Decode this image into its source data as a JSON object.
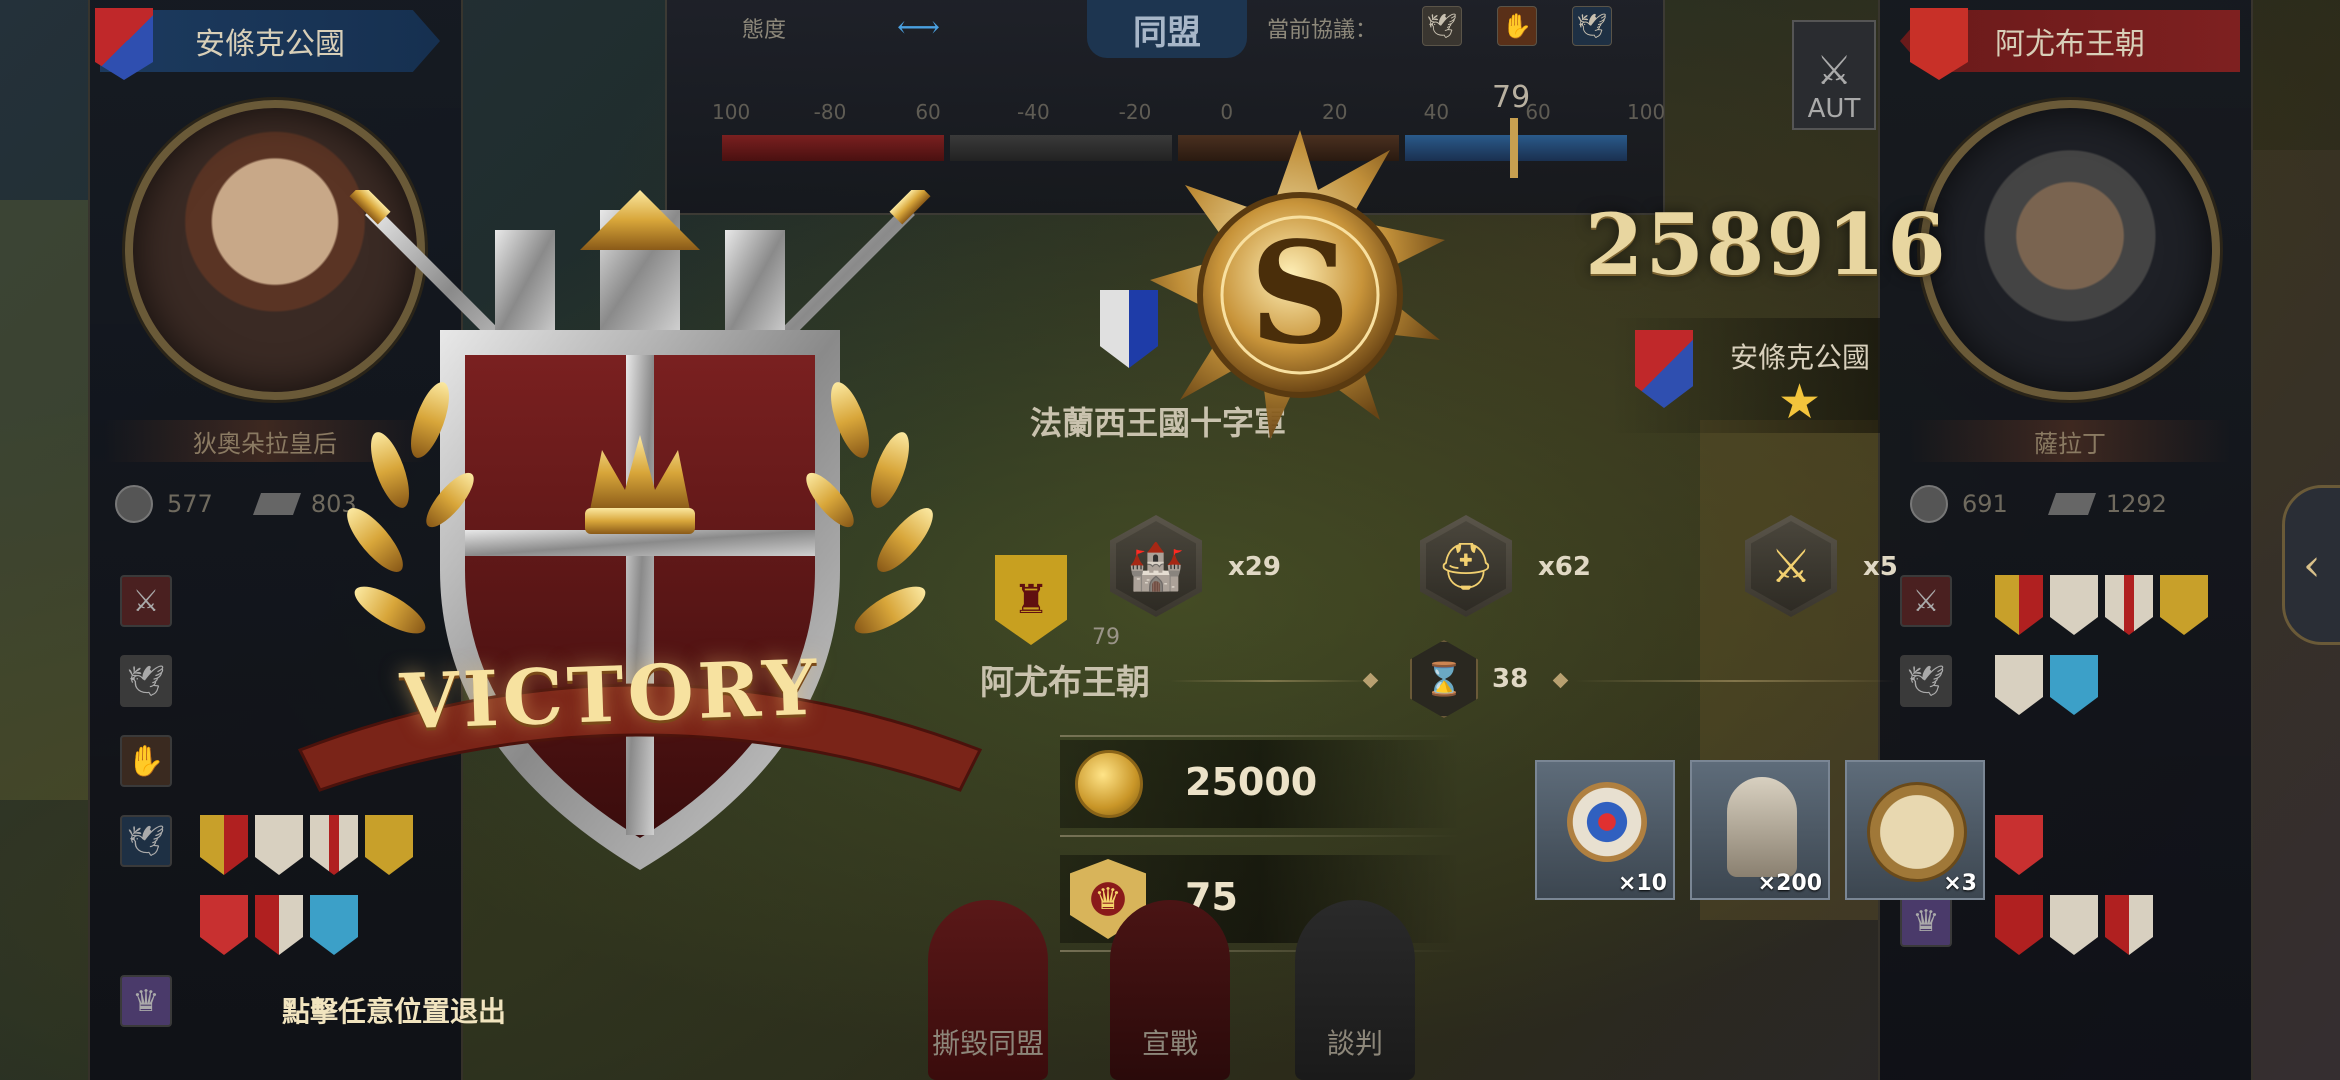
{
  "left_faction": {
    "name": "安條克公國",
    "ruler_title": "狄奧朵拉皇后",
    "stat_1": "577",
    "stat_2": "803",
    "flag_colors": [
      "#c0282a",
      "#2f4fb0"
    ]
  },
  "right_faction": {
    "name": "阿尤布王朝",
    "ruler_title": "薩拉丁",
    "stat_1": "691",
    "stat_2": "1292",
    "flag_colors": [
      "#c0282a",
      "#d4a62a"
    ]
  },
  "diplomacy": {
    "attitude_label": "態度",
    "relation_tab": "同盟",
    "treaty_label": "當前協議：",
    "scale_labels": [
      "100",
      "-80",
      "60",
      "-40",
      "-20",
      "0",
      "20",
      "40",
      "60",
      "100"
    ],
    "relation_value": "79"
  },
  "map": {
    "city_label": "法蘭西王國十字軍",
    "kingdom_label": "阿尤布王朝",
    "kingdom_marker_value": "79"
  },
  "result": {
    "banner_text": "VICTORY",
    "score": "258916",
    "winner_name": "安條克公國",
    "winner_star": "★"
  },
  "units": [
    {
      "icon": "castle-icon",
      "count": "x29"
    },
    {
      "icon": "helmet-icon",
      "count": "x62"
    },
    {
      "icon": "crossed-swords-icon",
      "count": "x5"
    }
  ],
  "turns": {
    "icon": "hourglass-icon",
    "count": "38"
  },
  "rewards": {
    "gold": "25000",
    "honor": "75"
  },
  "items": [
    {
      "icon": "archery-target-icon",
      "count": "×10"
    },
    {
      "icon": "soldier-bust-icon",
      "count": "×200"
    },
    {
      "icon": "compass-icon",
      "count": "×3"
    }
  ],
  "bottom_actions": {
    "break_alliance": "撕毀同盟",
    "declare_war": "宣戰",
    "negotiate": "談判"
  },
  "auto_label": "AUT",
  "exit_hint": "點擊任意位置退出",
  "colors": {
    "gold": "#e8d6a0",
    "alliance_blue": "#1d3550",
    "enemy_red": "#7e2020"
  }
}
